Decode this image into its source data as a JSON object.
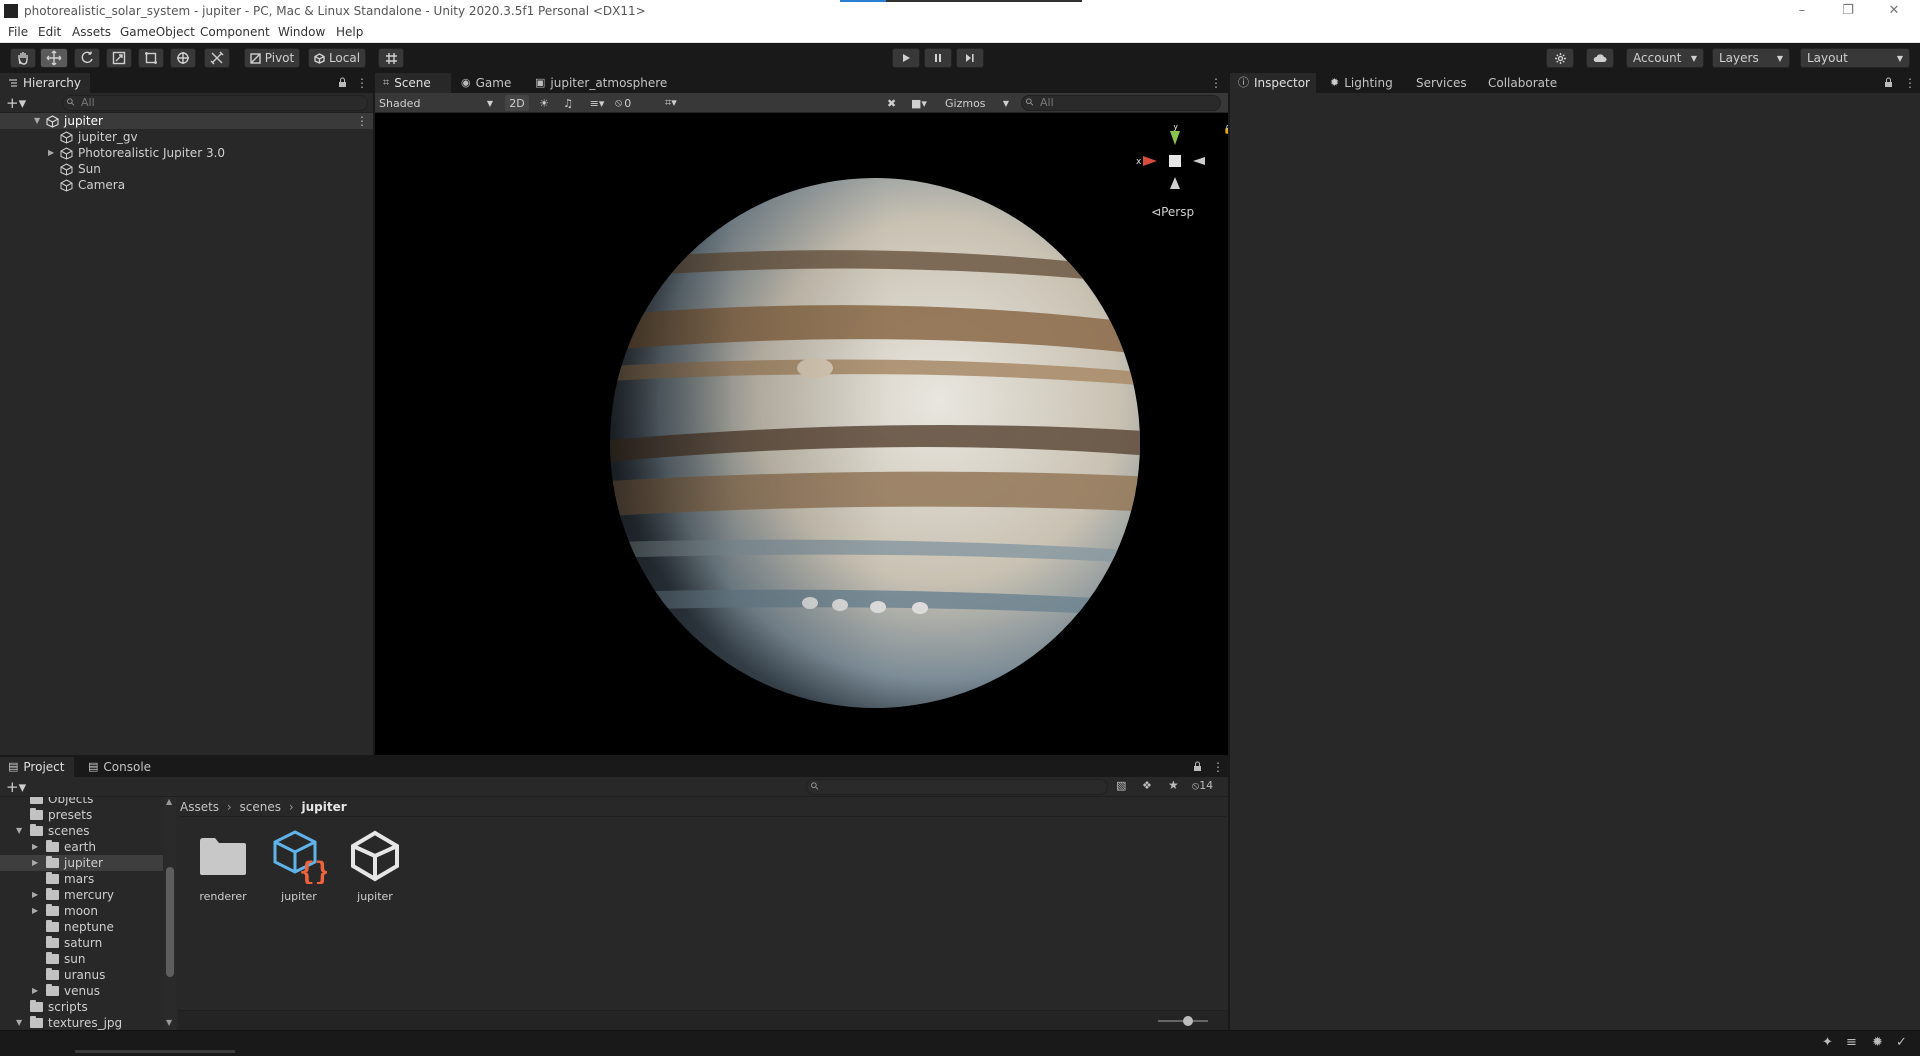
{
  "window": {
    "title": "photorealistic_solar_system - jupiter - PC, Mac & Linux Standalone - Unity 2020.3.5f1 Personal <DX11>",
    "controls": [
      "minimize",
      "restore",
      "close"
    ]
  },
  "menu": [
    "File",
    "Edit",
    "Assets",
    "GameObject",
    "Component",
    "Window",
    "Help"
  ],
  "toolbar": {
    "tools": [
      "hand-tool",
      "move-tool",
      "rotate-tool",
      "scale-tool",
      "rect-tool",
      "transform-tool",
      "custom-tool"
    ],
    "active_tool": "move-tool",
    "pivot_label": "Pivot",
    "local_label": "Local",
    "account_label": "Account",
    "layers_label": "Layers",
    "layout_label": "Layout"
  },
  "hierarchy": {
    "tab": "Hierarchy",
    "search_placeholder": "All",
    "scene": "jupiter",
    "items": [
      {
        "label": "jupiter_gv",
        "expandable": false
      },
      {
        "label": "Photorealistic Jupiter 3.0",
        "expandable": true
      },
      {
        "label": "Sun",
        "expandable": false
      },
      {
        "label": "Camera",
        "expandable": false
      }
    ]
  },
  "scene_view": {
    "tabs": [
      {
        "label": "Scene",
        "icon": "scene-icon",
        "selected": true
      },
      {
        "label": "Game",
        "icon": "game-icon",
        "selected": false
      },
      {
        "label": "jupiter_atmosphere",
        "icon": "shadergraph-icon",
        "selected": false
      }
    ],
    "draw_mode": "Shaded",
    "mode_2d": "2D",
    "hidden_count": "0",
    "gizmos_label": "Gizmos",
    "search_placeholder": "All",
    "projection_label": "Persp",
    "gizmo_axes": {
      "x": "x",
      "y": "y"
    }
  },
  "inspector": {
    "tabs": [
      {
        "label": "Inspector",
        "icon": "info-icon"
      },
      {
        "label": "Lighting",
        "icon": "bulb-icon"
      },
      {
        "label": "Services",
        "icon": ""
      },
      {
        "label": "Collaborate",
        "icon": ""
      }
    ]
  },
  "project": {
    "tabs": [
      {
        "label": "Project",
        "icon": "folder-icon",
        "selected": true
      },
      {
        "label": "Console",
        "icon": "console-icon",
        "selected": false
      }
    ],
    "hidden_count": "14",
    "breadcrumb": [
      "Assets",
      "scenes",
      "jupiter"
    ],
    "tree": [
      {
        "label": "Objects",
        "arrow": "",
        "indent": 1
      },
      {
        "label": "presets",
        "arrow": "",
        "indent": 1
      },
      {
        "label": "scenes",
        "arrow": "down",
        "indent": 1
      },
      {
        "label": "earth",
        "arrow": "right",
        "indent": 2
      },
      {
        "label": "jupiter",
        "arrow": "right",
        "indent": 2,
        "selected": true
      },
      {
        "label": "mars",
        "arrow": "",
        "indent": 2
      },
      {
        "label": "mercury",
        "arrow": "right",
        "indent": 2
      },
      {
        "label": "moon",
        "arrow": "right",
        "indent": 2
      },
      {
        "label": "neptune",
        "arrow": "",
        "indent": 2
      },
      {
        "label": "saturn",
        "arrow": "",
        "indent": 2
      },
      {
        "label": "sun",
        "arrow": "",
        "indent": 2
      },
      {
        "label": "uranus",
        "arrow": "",
        "indent": 2
      },
      {
        "label": "venus",
        "arrow": "right",
        "indent": 2
      },
      {
        "label": "scripts",
        "arrow": "",
        "indent": 1
      },
      {
        "label": "textures_jpg",
        "arrow": "down",
        "indent": 1
      }
    ],
    "assets": [
      {
        "label": "renderer",
        "icon": "folder-icon"
      },
      {
        "label": "jupiter",
        "icon": "prefab-variant-icon"
      },
      {
        "label": "jupiter",
        "icon": "unity-scene-icon"
      }
    ],
    "zoom_slider": 0.6
  },
  "colors": {
    "accent_selection": "#2c5d87",
    "panel_bg": "#282828",
    "toolbar_bg": "#191919",
    "gizmo_x": "#d84a3a",
    "gizmo_y": "#8bc34a"
  }
}
